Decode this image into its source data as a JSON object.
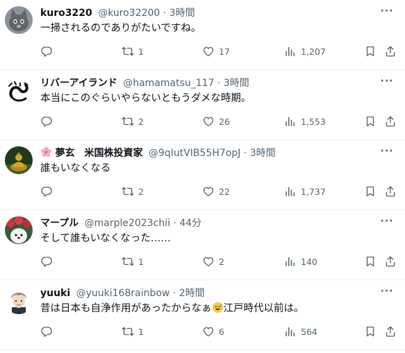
{
  "tweets": [
    {
      "name": "kuro3220",
      "handle": "@kuro32200",
      "separator": "·",
      "time": "3時間",
      "text": "一掃されるのでありがたいですね。",
      "replies": "",
      "retweets": "1",
      "likes": "17",
      "views": "1,207",
      "avatar_icon": "cat-avatar"
    },
    {
      "name": "リバーアイランド",
      "handle": "@hamamatsu_117",
      "separator": "·",
      "time": "3時間",
      "text": "本当にこのぐらいやらないともうダメな時期。",
      "replies": "",
      "retweets": "2",
      "likes": "26",
      "views": "1,553",
      "avatar_icon": "dragon-avatar"
    },
    {
      "name_emoji": "cherry-blossom-icon",
      "name": "夢玄　米国株投資家",
      "handle": "@9qIutVIB55H7opJ",
      "separator": "·",
      "time": "3時間",
      "text": "誰もいなくなる",
      "replies": "",
      "retweets": "2",
      "likes": "22",
      "views": "1,737",
      "avatar_icon": "buddha-statue-avatar"
    },
    {
      "name": "マープル",
      "handle": "@marple2023chii",
      "separator": "·",
      "time": "44分",
      "text": "そして誰もいなくなった……",
      "replies": "",
      "retweets": "1",
      "likes": "2",
      "views": "140",
      "avatar_icon": "dog-with-flowers-avatar"
    },
    {
      "name": "yuuki",
      "handle": "@yuuki168rainbow",
      "separator": "·",
      "time": "2時間",
      "text_before": "昔は日本も自浄作用があったからなぁ",
      "text_emoji": "sweat-smile-emoji",
      "text_after": "江戸時代以前は。",
      "replies": "",
      "retweets": "1",
      "likes": "6",
      "views": "564",
      "avatar_icon": "anime-boy-avatar"
    }
  ],
  "colors": {
    "text_primary": "#0f1419",
    "text_secondary": "#536471",
    "divider": "#eff3f4"
  }
}
